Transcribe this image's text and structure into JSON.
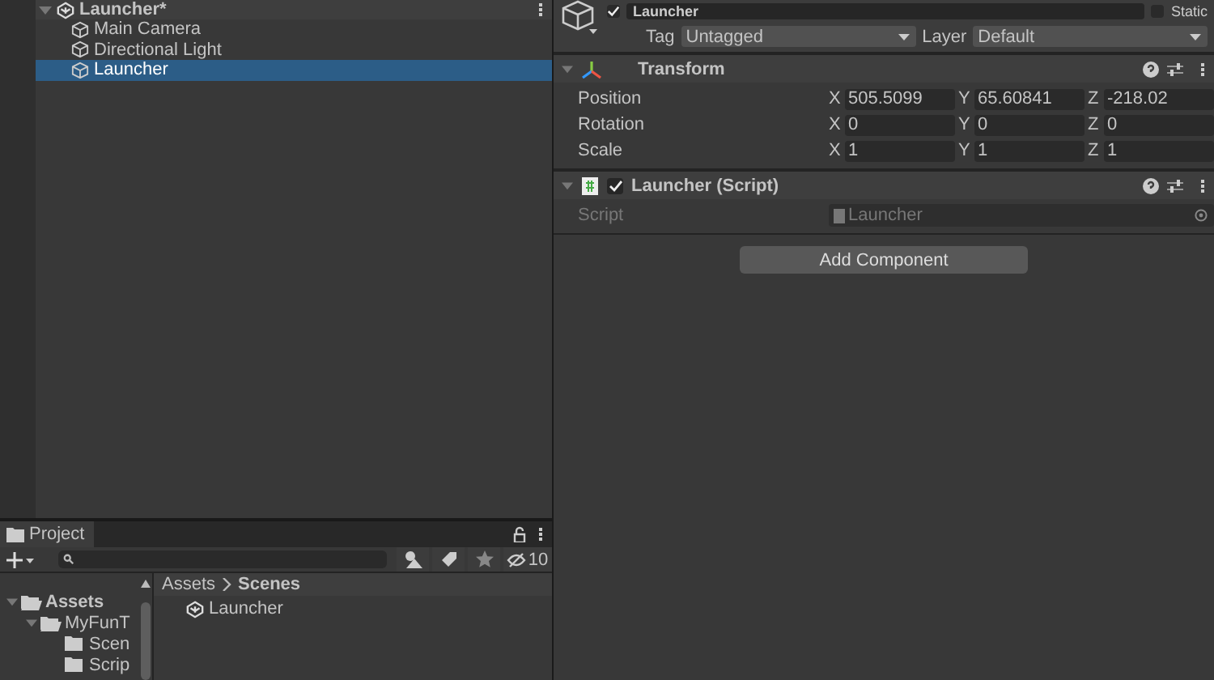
{
  "hierarchy": {
    "scene": {
      "label": "Launcher*",
      "expanded": true
    },
    "items": [
      {
        "label": "Main Camera",
        "selected": false
      },
      {
        "label": "Directional Light",
        "selected": false
      },
      {
        "label": "Launcher",
        "selected": true
      }
    ]
  },
  "project": {
    "tab": "Project",
    "filter_count": "10",
    "tree": [
      {
        "label": "Assets",
        "expanded": true,
        "children": [
          {
            "label": "MyFunT",
            "expanded": true,
            "children": [
              {
                "label": "Scen"
              },
              {
                "label": "Scrip"
              }
            ]
          }
        ]
      }
    ],
    "breadcrumb": [
      "Assets",
      "Scenes"
    ],
    "files": [
      {
        "label": "Launcher"
      }
    ]
  },
  "inspector": {
    "active": true,
    "static": false,
    "name": "Launcher",
    "static_label": "Static",
    "tag_label": "Tag",
    "tag": "Untagged",
    "layer_label": "Layer",
    "layer": "Default",
    "components": [
      {
        "kind": "transform",
        "title": "Transform",
        "expanded": true,
        "rows": [
          {
            "label": "Position",
            "values": [
              {
                "axis": "X",
                "value": "505.5099"
              },
              {
                "axis": "Y",
                "value": "65.60841"
              },
              {
                "axis": "Z",
                "value": "-218.02"
              }
            ]
          },
          {
            "label": "Rotation",
            "values": [
              {
                "axis": "X",
                "value": "0"
              },
              {
                "axis": "Y",
                "value": "0"
              },
              {
                "axis": "Z",
                "value": "0"
              }
            ]
          },
          {
            "label": "Scale",
            "values": [
              {
                "axis": "X",
                "value": "1"
              },
              {
                "axis": "Y",
                "value": "1"
              },
              {
                "axis": "Z",
                "value": "1"
              }
            ]
          }
        ]
      },
      {
        "kind": "script",
        "title": "Launcher (Script)",
        "expanded": true,
        "enabled": true,
        "field_label": "Script",
        "field_value": "Launcher"
      }
    ],
    "add_button": "Add Component"
  }
}
